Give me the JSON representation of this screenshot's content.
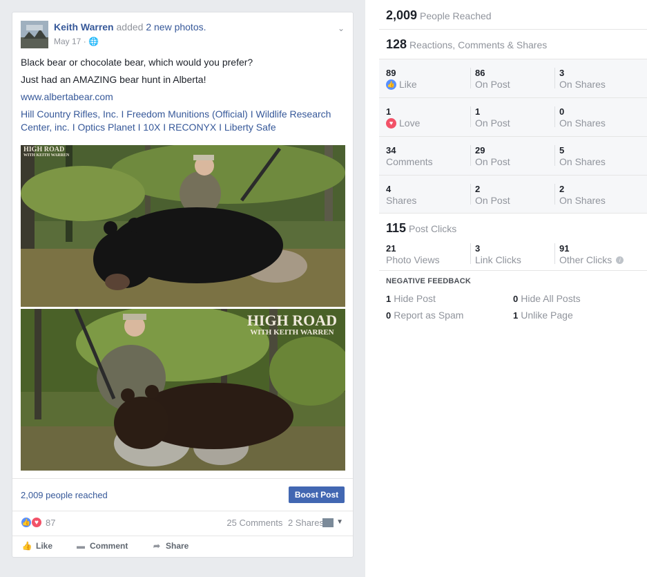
{
  "post": {
    "author": "Keith Warren",
    "action_text": "added",
    "action_link": "2 new photos.",
    "date": "May 17",
    "separator": "·",
    "line1": "Black bear or chocolate bear, which would you prefer?",
    "line2": "Just had an AMAZING bear hunt in Alberta!",
    "link": "www.albertabear.com",
    "sponsors": "Hill Country Rifles, Inc. I Freedom Munitions (Official) I Wildlife Research Center, inc. I Optics Planet I 10X I RECONYX I Liberty Safe",
    "watermark_line1": "HIGH ROAD",
    "watermark_line2": "WITH KEITH WARREN",
    "people_reached_link": "2,009 people reached",
    "boost_label": "Boost Post",
    "reaction_count": "87",
    "comments": "25 Comments",
    "shares": "2 Shares",
    "actions": {
      "like": "Like",
      "comment": "Comment",
      "share": "Share"
    }
  },
  "insights": {
    "people_reached": {
      "value": "2,009",
      "label": "People Reached"
    },
    "engagement": {
      "value": "128",
      "label": "Reactions, Comments & Shares"
    },
    "rows": [
      {
        "cells": [
          {
            "n": "89",
            "l": "Like",
            "icon": "like-icon"
          },
          {
            "n": "86",
            "l": "On Post"
          },
          {
            "n": "3",
            "l": "On Shares"
          }
        ]
      },
      {
        "cells": [
          {
            "n": "1",
            "l": "Love",
            "icon": "love-icon"
          },
          {
            "n": "1",
            "l": "On Post"
          },
          {
            "n": "0",
            "l": "On Shares"
          }
        ]
      },
      {
        "cells": [
          {
            "n": "34",
            "l": "Comments"
          },
          {
            "n": "29",
            "l": "On Post"
          },
          {
            "n": "5",
            "l": "On Shares"
          }
        ]
      },
      {
        "cells": [
          {
            "n": "4",
            "l": "Shares"
          },
          {
            "n": "2",
            "l": "On Post"
          },
          {
            "n": "2",
            "l": "On Shares"
          }
        ]
      }
    ],
    "post_clicks": {
      "value": "115",
      "label": "Post Clicks"
    },
    "clicks": [
      {
        "n": "21",
        "l": "Photo Views"
      },
      {
        "n": "3",
        "l": "Link Clicks"
      },
      {
        "n": "91",
        "l": "Other Clicks"
      }
    ],
    "negative_title": "NEGATIVE FEEDBACK",
    "negative": [
      {
        "n": "1",
        "l": "Hide Post"
      },
      {
        "n": "0",
        "l": "Hide All Posts"
      },
      {
        "n": "0",
        "l": "Report as Spam"
      },
      {
        "n": "1",
        "l": "Unlike Page"
      }
    ]
  },
  "colors": {
    "link": "#365899",
    "boost": "#4267b2",
    "like": "#5890ff",
    "love": "#f25268",
    "muted": "#90949c"
  }
}
